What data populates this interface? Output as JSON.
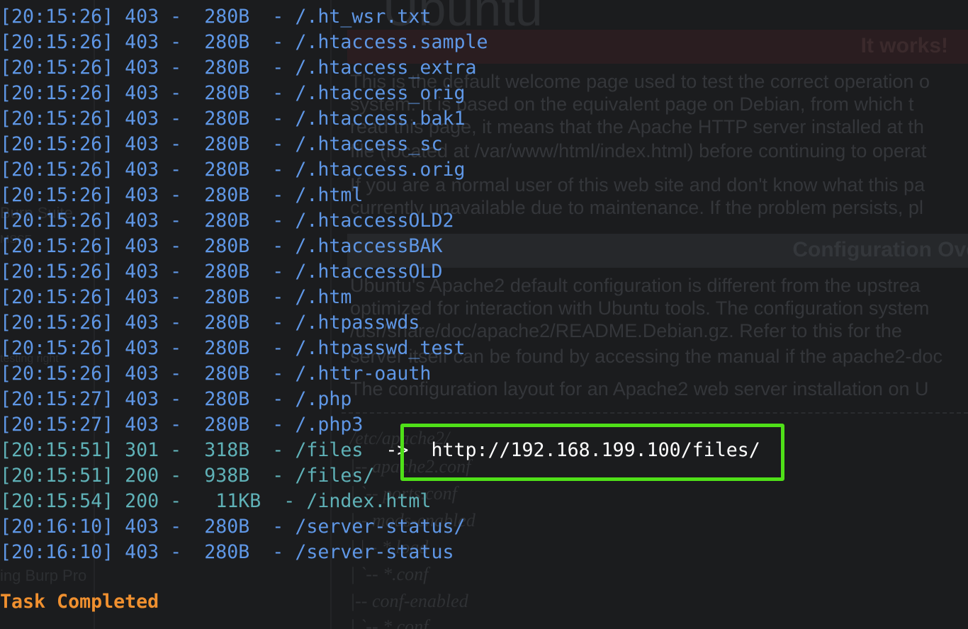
{
  "background": {
    "logo_text": "Ubuntu",
    "it_works_title": "It works!",
    "config_title": "Configuration Ove",
    "paragraph_lines": [
      "This is the default welcome page used to test the correct operation o",
      "system. It is based on the equivalent page on Debian, from which t",
      "read this page, it means that the Apache HTTP server installed at th",
      "file (located at /var/www/html/index.html) before continuing to operat",
      "If you are a normal user of this web site and don't know what this pa",
      "currently unavailable due to maintenance. If the problem persists, pl"
    ],
    "config_lines": [
      "Ubuntu's Apache2 default configuration is different from the upstrea",
      "optimized for interaction with Ubuntu tools. The configuration system",
      "/usr/share/doc/apache2/README.Debian.gz. Refer to this for the",
      "server itself can be found by accessing the manual if the apache2-doc",
      "The configuration layout for an Apache2 web server installation on U"
    ],
    "tree_lines": [
      "/etc/apache2/",
      "|-- apache2.conf",
      "|       `--  ports.conf",
      "|-- mods-enabled",
      "|       |-- *.load",
      "|       `-- *.conf",
      "|-- conf-enabled",
      "|       `-- *.conf"
    ],
    "left_fragments": [
      "Burp Suite",
      "MSSF",
      "testing right",
      "ing Burp Pro"
    ]
  },
  "terminal": {
    "rows": [
      {
        "ts": "[20:15:26]",
        "status": "403",
        "size": "280B",
        "path": "/.ht_wsr.txt",
        "redirect": "",
        "ok": false
      },
      {
        "ts": "[20:15:26]",
        "status": "403",
        "size": "280B",
        "path": "/.htaccess.sample",
        "redirect": "",
        "ok": false
      },
      {
        "ts": "[20:15:26]",
        "status": "403",
        "size": "280B",
        "path": "/.htaccess_extra",
        "redirect": "",
        "ok": false
      },
      {
        "ts": "[20:15:26]",
        "status": "403",
        "size": "280B",
        "path": "/.htaccess_orig",
        "redirect": "",
        "ok": false
      },
      {
        "ts": "[20:15:26]",
        "status": "403",
        "size": "280B",
        "path": "/.htaccess.bak1",
        "redirect": "",
        "ok": false
      },
      {
        "ts": "[20:15:26]",
        "status": "403",
        "size": "280B",
        "path": "/.htaccess_sc",
        "redirect": "",
        "ok": false
      },
      {
        "ts": "[20:15:26]",
        "status": "403",
        "size": "280B",
        "path": "/.htaccess.orig",
        "redirect": "",
        "ok": false
      },
      {
        "ts": "[20:15:26]",
        "status": "403",
        "size": "280B",
        "path": "/.html",
        "redirect": "",
        "ok": false
      },
      {
        "ts": "[20:15:26]",
        "status": "403",
        "size": "280B",
        "path": "/.htaccessOLD2",
        "redirect": "",
        "ok": false
      },
      {
        "ts": "[20:15:26]",
        "status": "403",
        "size": "280B",
        "path": "/.htaccessBAK",
        "redirect": "",
        "ok": false
      },
      {
        "ts": "[20:15:26]",
        "status": "403",
        "size": "280B",
        "path": "/.htaccessOLD",
        "redirect": "",
        "ok": false
      },
      {
        "ts": "[20:15:26]",
        "status": "403",
        "size": "280B",
        "path": "/.htm",
        "redirect": "",
        "ok": false
      },
      {
        "ts": "[20:15:26]",
        "status": "403",
        "size": "280B",
        "path": "/.htpasswds",
        "redirect": "",
        "ok": false
      },
      {
        "ts": "[20:15:26]",
        "status": "403",
        "size": "280B",
        "path": "/.htpasswd_test",
        "redirect": "",
        "ok": false
      },
      {
        "ts": "[20:15:26]",
        "status": "403",
        "size": "280B",
        "path": "/.httr-oauth",
        "redirect": "",
        "ok": false
      },
      {
        "ts": "[20:15:27]",
        "status": "403",
        "size": "280B",
        "path": "/.php",
        "redirect": "",
        "ok": false
      },
      {
        "ts": "[20:15:27]",
        "status": "403",
        "size": "280B",
        "path": "/.php3",
        "redirect": "",
        "ok": false
      },
      {
        "ts": "[20:15:51]",
        "status": "301",
        "size": "318B",
        "path": "/files",
        "redirect": "  ->  http://192.168.199.100/files/",
        "ok": true
      },
      {
        "ts": "[20:15:51]",
        "status": "200",
        "size": "938B",
        "path": "/files/",
        "redirect": "",
        "ok": true
      },
      {
        "ts": "[20:15:54]",
        "status": "200",
        "size": " 11KB",
        "path": "/index.html",
        "redirect": "",
        "ok": true
      },
      {
        "ts": "[20:16:10]",
        "status": "403",
        "size": "280B",
        "path": "/server-status/",
        "redirect": "",
        "ok": false
      },
      {
        "ts": "[20:16:10]",
        "status": "403",
        "size": "280B",
        "path": "/server-status",
        "redirect": "",
        "ok": false
      }
    ],
    "task_message": "Task Completed"
  },
  "colors": {
    "forbidden": "#5f97e6",
    "success": "#5fb1b7",
    "redirect_url": "#ffffff",
    "task": "#f0902f",
    "highlight": "#4fe018"
  }
}
